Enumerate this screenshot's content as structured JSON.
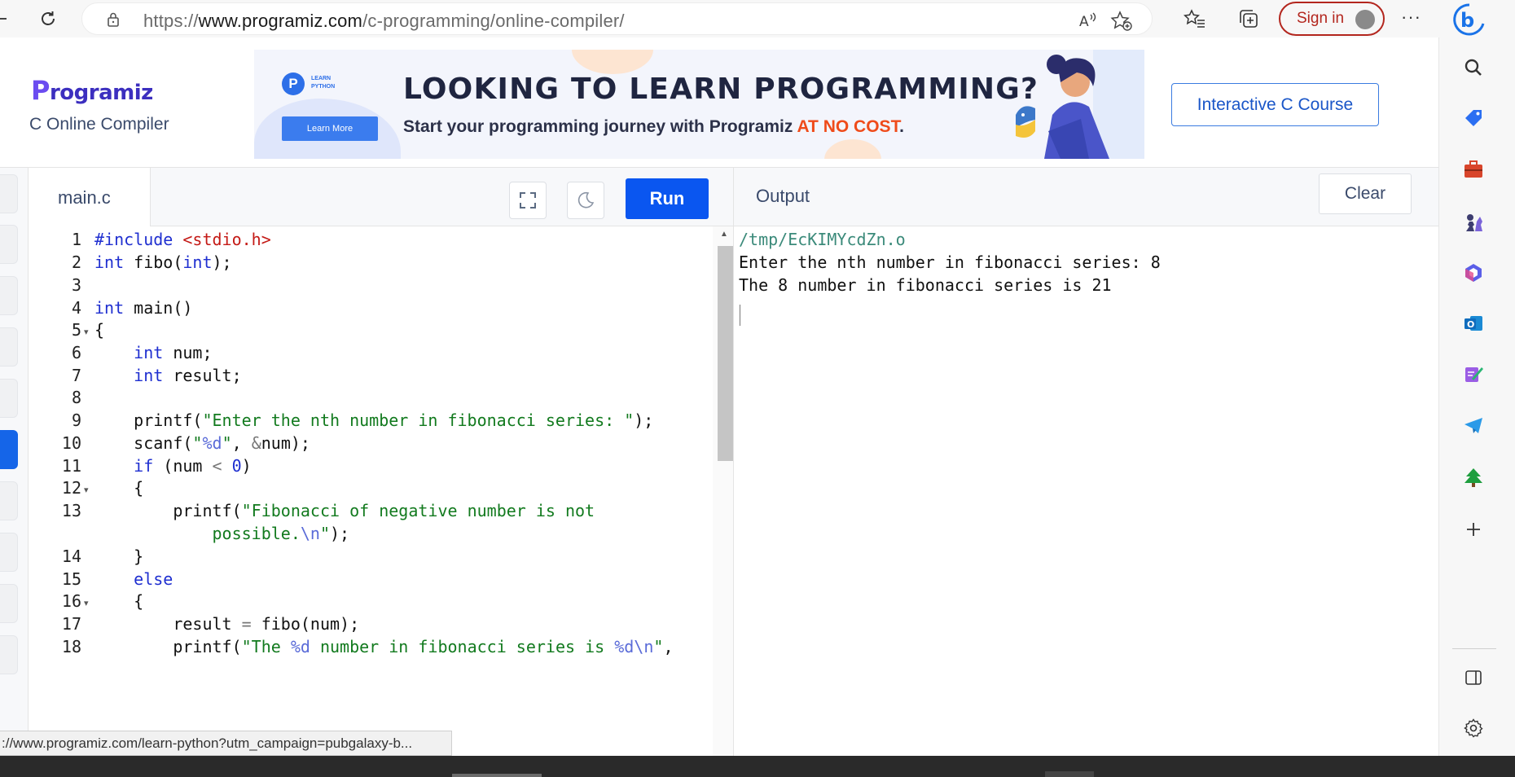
{
  "browser": {
    "url_prefix": "https://",
    "url_domain": "www.programiz.com",
    "url_path": "/c-programming/online-compiler/",
    "signin_label": "Sign in",
    "more_label": "···"
  },
  "header": {
    "logo_p": "P",
    "logo_rest": "rogramiz",
    "subtitle": "C Online Compiler",
    "course_button": "Interactive C Course"
  },
  "ad": {
    "badge_letter": "P",
    "badge_text_1": "LEARN",
    "badge_text_2": "PYTHON",
    "learn_more": "Learn More",
    "title": "LOOKING TO LEARN PROGRAMMING?",
    "subtitle_main": "Start your programming journey with Programiz ",
    "subtitle_highlight": "AT NO COST",
    "subtitle_end": "."
  },
  "editor": {
    "tab_label": "main.c",
    "run_label": "Run",
    "line_numbers": [
      "1",
      "2",
      "3",
      "4",
      "5",
      "6",
      "7",
      "8",
      "9",
      "10",
      "11",
      "12",
      "13",
      "14",
      "15",
      "16",
      "17",
      "18"
    ]
  },
  "output": {
    "title": "Output",
    "clear_label": "Clear",
    "lines": [
      "/tmp/EcKIMYcdZn.o",
      "Enter the nth number in fibonacci series: 8",
      "The 8 number in fibonacci series is 21"
    ]
  },
  "status_bar": {
    "hover_url": "://www.programiz.com/learn-python?utm_campaign=pubgalaxy-b..."
  },
  "colors": {
    "run_button": "#0a56f0",
    "signin_border": "#b3261e",
    "keyword": "#1f2fd0",
    "string": "#127a1e",
    "include": "#c41a16",
    "ad_highlight": "#ef4b1a"
  },
  "icons": {
    "toolbar": [
      "back-icon",
      "refresh-icon",
      "lock-icon",
      "read-aloud-icon",
      "add-favorite-icon",
      "favorites-icon",
      "collections-icon",
      "bing-icon"
    ],
    "sidebar": [
      "search-icon",
      "shopping-tag-icon",
      "tools-icon",
      "games-icon",
      "microsoft365-icon",
      "outlook-icon",
      "designer-icon",
      "telegram-icon",
      "tree-icon",
      "add-icon",
      "sidebar-toggle-icon",
      "settings-icon"
    ],
    "editor": [
      "fullscreen-icon",
      "dark-mode-icon"
    ]
  }
}
